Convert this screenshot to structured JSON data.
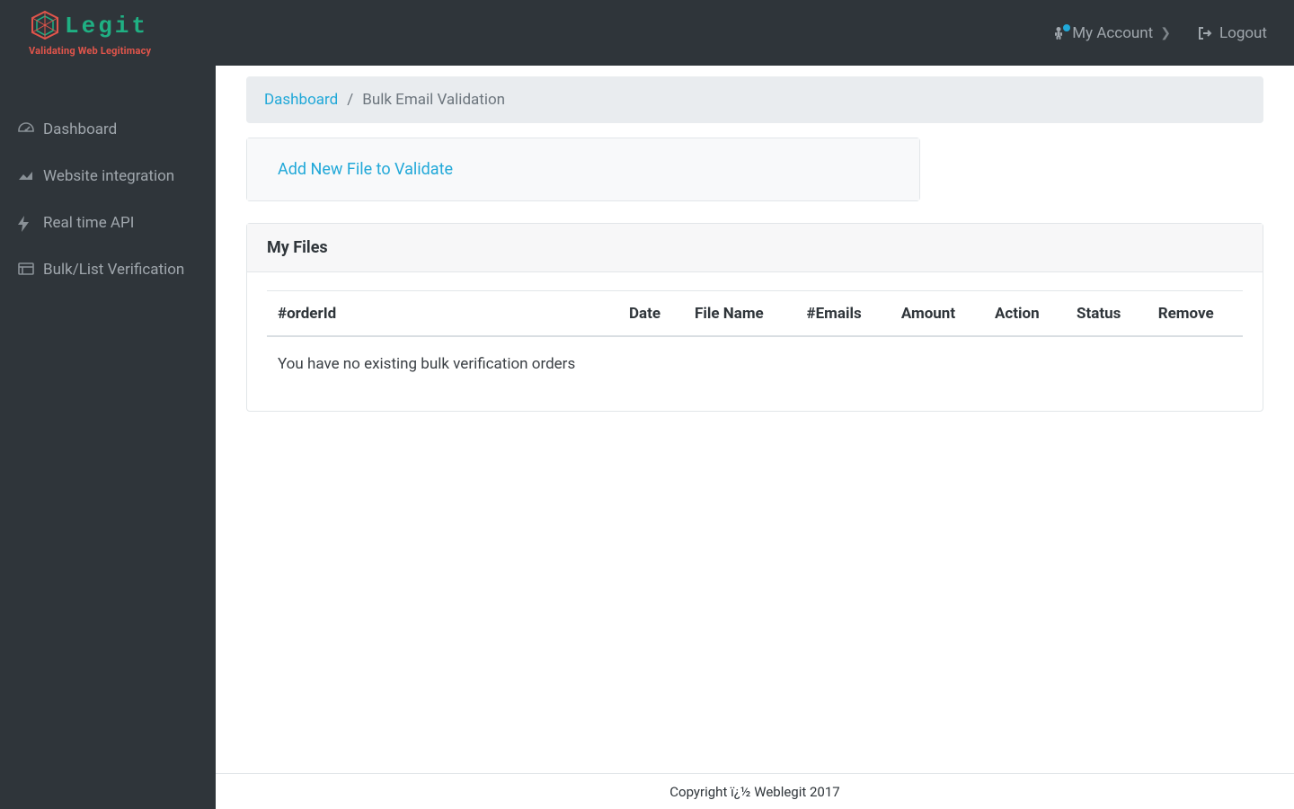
{
  "brand": {
    "name": "Legit",
    "tagline": "Validating Web Legitimacy"
  },
  "header": {
    "my_account_label": "My Account",
    "logout_label": "Logout"
  },
  "sidebar": {
    "items": [
      {
        "label": "Dashboard"
      },
      {
        "label": "Website integration"
      },
      {
        "label": "Real time API"
      },
      {
        "label": "Bulk/List Verification"
      }
    ]
  },
  "breadcrumb": {
    "root": "Dashboard",
    "separator": "/",
    "current": "Bulk Email Validation"
  },
  "add_file": {
    "label": "Add New File to Validate"
  },
  "files_panel": {
    "title": "My Files",
    "columns": [
      "#orderId",
      "Date",
      "File Name",
      "#Emails",
      "Amount",
      "Action",
      "Status",
      "Remove"
    ],
    "empty_message": "You have no existing bulk verification orders"
  },
  "footer": {
    "text": "Copyright ï¿½ Weblegit 2017"
  }
}
